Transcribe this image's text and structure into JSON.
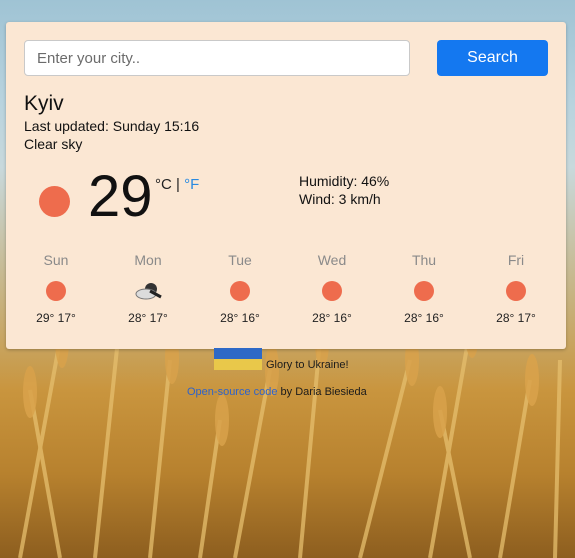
{
  "search": {
    "placeholder": "Enter your city..",
    "button_label": "Search"
  },
  "current": {
    "city": "Kyiv",
    "last_updated": "Last updated: Sunday 15:16",
    "description": "Clear sky",
    "icon": "sun-icon",
    "temperature": "29",
    "unit_c": "°C",
    "unit_separator": "|",
    "unit_f": "°F",
    "humidity": "Humidity: 46%",
    "wind": "Wind: 3 km/h"
  },
  "forecast": [
    {
      "day": "Sun",
      "icon": "sun-icon",
      "temps": "29° 17°"
    },
    {
      "day": "Mon",
      "icon": "cloudy-icon",
      "temps": "28° 17°"
    },
    {
      "day": "Tue",
      "icon": "sun-icon",
      "temps": "28° 16°"
    },
    {
      "day": "Wed",
      "icon": "sun-icon",
      "temps": "28° 16°"
    },
    {
      "day": "Thu",
      "icon": "sun-icon",
      "temps": "28° 16°"
    },
    {
      "day": "Fri",
      "icon": "sun-icon",
      "temps": "28° 17°"
    }
  ],
  "footer": {
    "slogan": "Glory to Ukraine!",
    "code_link": "Open-source code",
    "author": " by Daria Biesieda"
  },
  "colors": {
    "accent": "#1478f0",
    "sun": "#ee6c4d",
    "card": "#fbe7d3",
    "fahrenheit_link": "#2a8ae0"
  }
}
